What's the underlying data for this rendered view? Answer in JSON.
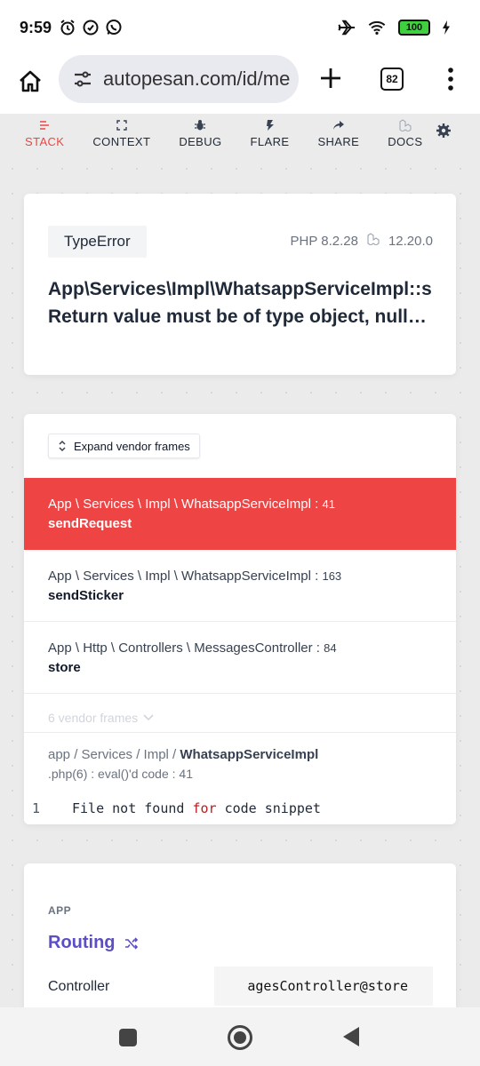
{
  "status_bar": {
    "time": "9:59",
    "battery": "100"
  },
  "browser": {
    "url": "autopesan.com/id/me",
    "tab_count": "82"
  },
  "nav": {
    "items": [
      {
        "label": "STACK",
        "icon": "stack-icon",
        "active": true
      },
      {
        "label": "CONTEXT",
        "icon": "context-icon"
      },
      {
        "label": "DEBUG",
        "icon": "bug-icon"
      },
      {
        "label": "FLARE",
        "icon": "flare-icon"
      },
      {
        "label": "SHARE",
        "icon": "share-icon"
      },
      {
        "label": "DOCS",
        "icon": "docs-icon"
      }
    ],
    "settings_icon": "gear-icon",
    "active_color": "#ef4444"
  },
  "error": {
    "type": "TypeError",
    "php_version": "PHP 8.2.28",
    "laravel_version": "12.20.0",
    "title_line1": "App\\Services\\Impl\\WhatsappServiceImpl::s",
    "title_line2": "Return value must be of type object, null…"
  },
  "stack": {
    "expand_label": "Expand vendor frames",
    "frames": [
      {
        "path": "App \\ Services \\ Impl \\ WhatsappServiceImpl",
        "line": "41",
        "method": "sendRequest",
        "active": true
      },
      {
        "path": "App \\ Services \\ Impl \\ WhatsappServiceImpl",
        "line": "163",
        "method": "sendSticker"
      },
      {
        "path": "App \\ Http \\ Controllers \\ MessagesController",
        "line": "84",
        "method": "store"
      }
    ],
    "vendor_frames_label": "6 vendor frames",
    "snippet": {
      "file_prefix": "app / Services / Impl / ",
      "file_name": "WhatsappServiceImpl",
      "file_suffix": ".php(6) : eval()'d code",
      "line": "41",
      "code_line_number": "1",
      "code_before": "File not found ",
      "code_keyword": "for",
      "code_after": " code snippet"
    }
  },
  "app": {
    "section_label": "APP",
    "routing_label": "Routing",
    "controller_label": "Controller",
    "controller_value": "agesController@store"
  }
}
